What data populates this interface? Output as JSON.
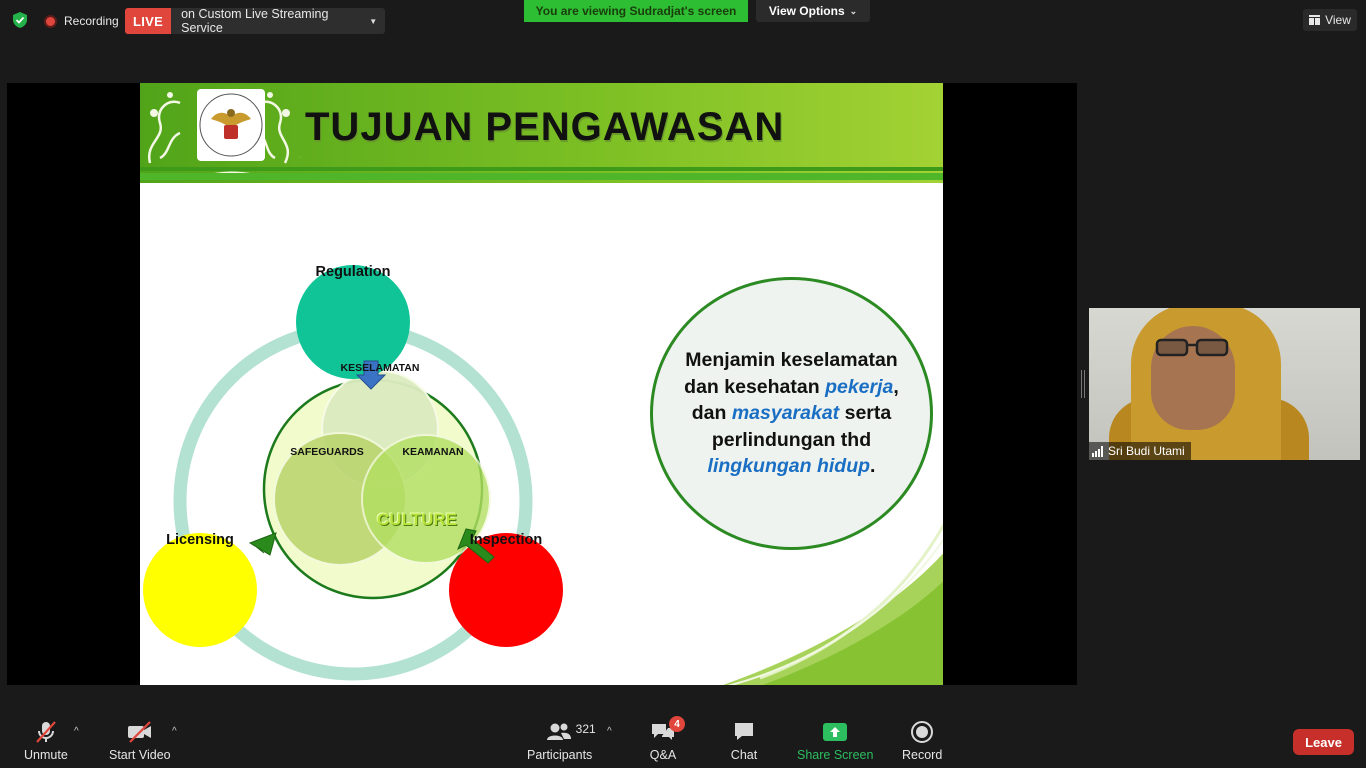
{
  "top_bar": {
    "recording_label": "Recording",
    "live_badge": "LIVE",
    "live_service": "on Custom Live Streaming Service",
    "viewing_banner": "You are viewing Sudradjat's screen",
    "view_options": "View Options",
    "view_label": "View"
  },
  "slide": {
    "title": "TUJUAN PENGAWASAN",
    "logo_text": "BADAN PENGAWAS TENAGA NUKLIR",
    "nodes": {
      "regulation": "Regulation",
      "licensing": "Licensing",
      "inspection": "Inspection"
    },
    "inner": {
      "keselamatan": "KESELAMATAN",
      "safeguards": "SAFEGUARDS",
      "keamanan": "KEAMANAN",
      "culture": "CULTURE"
    },
    "statement": {
      "part1": "Menjamin keselamatan dan kesehatan",
      "em1": "pekerja",
      "part2": ", dan",
      "em2": "masyarakat",
      "part3": " serta perlindungan thd",
      "em3": "lingkungan hidup",
      "part4": "."
    }
  },
  "video": {
    "participant_name": "Sri Budi Utami"
  },
  "toolbar": {
    "unmute": "Unmute",
    "start_video": "Start Video",
    "participants": "Participants",
    "participants_count": "321",
    "qa": "Q&A",
    "qa_badge": "4",
    "chat": "Chat",
    "share_screen": "Share Screen",
    "record": "Record",
    "leave": "Leave"
  },
  "colors": {
    "live_red": "#e0463b",
    "viewing_green": "#2dbe33",
    "share_green": "#2dbe60",
    "leave_red": "#c7302a",
    "regulation_teal": "#10c497",
    "licensing_yellow": "#ffff00",
    "inspection_red": "#ff0000"
  }
}
